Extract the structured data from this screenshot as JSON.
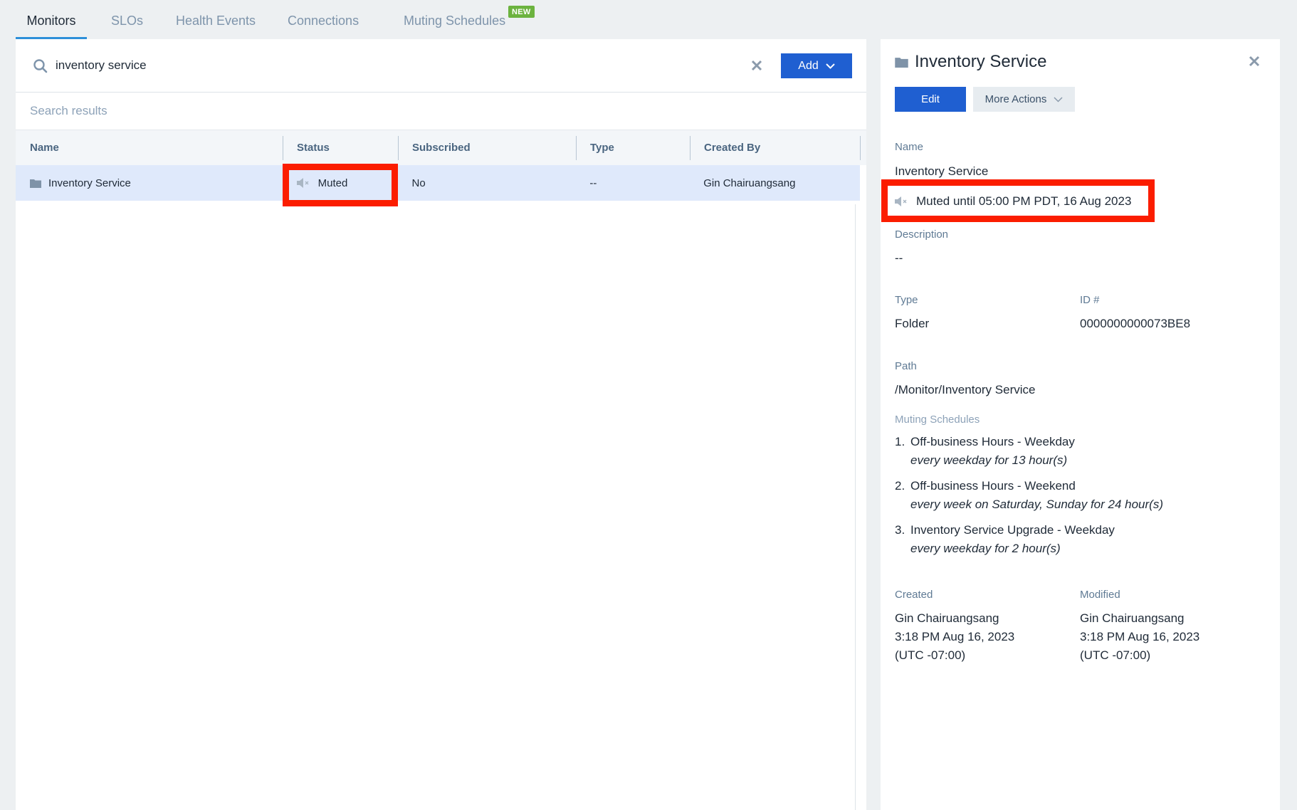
{
  "tabs": [
    {
      "label": "Monitors",
      "active": true
    },
    {
      "label": "SLOs",
      "active": false
    },
    {
      "label": "Health Events",
      "active": false
    },
    {
      "label": "Connections",
      "active": false
    },
    {
      "label": "Muting Schedules",
      "active": false,
      "badge": "NEW"
    }
  ],
  "search": {
    "value": "inventory service",
    "results_label": "Search results",
    "add_label": "Add"
  },
  "table": {
    "columns": [
      "Name",
      "Status",
      "Subscribed",
      "Type",
      "Created By"
    ],
    "rows": [
      {
        "name": "Inventory Service",
        "status": "Muted",
        "subscribed": "No",
        "type": "--",
        "created_by": "Gin Chairuangsang",
        "icon": "folder-icon",
        "selected": true
      }
    ]
  },
  "detail": {
    "title": "Inventory Service",
    "edit_label": "Edit",
    "more_actions_label": "More Actions",
    "name_label": "Name",
    "name_value": "Inventory Service",
    "muted_text": "Muted until 05:00 PM PDT, 16 Aug 2023",
    "description_label": "Description",
    "description_value": "--",
    "type_label": "Type",
    "type_value": "Folder",
    "id_label": "ID #",
    "id_value": "0000000000073BE8",
    "path_label": "Path",
    "path_value": "/Monitor/Inventory Service",
    "muting_schedules_label": "Muting Schedules",
    "muting_schedules": [
      {
        "num": "1.",
        "name": "Off-business Hours - Weekday",
        "desc": "every weekday for 13 hour(s)"
      },
      {
        "num": "2.",
        "name": "Off-business Hours - Weekend",
        "desc": "every week on Saturday, Sunday for 24 hour(s)"
      },
      {
        "num": "3.",
        "name": "Inventory Service Upgrade - Weekday",
        "desc": "every weekday for 2 hour(s)"
      }
    ],
    "created_label": "Created",
    "created_by": "Gin Chairuangsang",
    "created_time": "3:18 PM Aug 16, 2023",
    "created_tz": "(UTC -07:00)",
    "modified_label": "Modified",
    "modified_by": "Gin Chairuangsang",
    "modified_time": "3:18 PM Aug 16, 2023",
    "modified_tz": "(UTC -07:00)"
  },
  "colors": {
    "primary": "#1f5fd1",
    "tab_underline": "#2d8fd9",
    "badge_new": "#6cb33f",
    "highlight": "#fb1d00",
    "row_selected": "#dfe9fb"
  }
}
